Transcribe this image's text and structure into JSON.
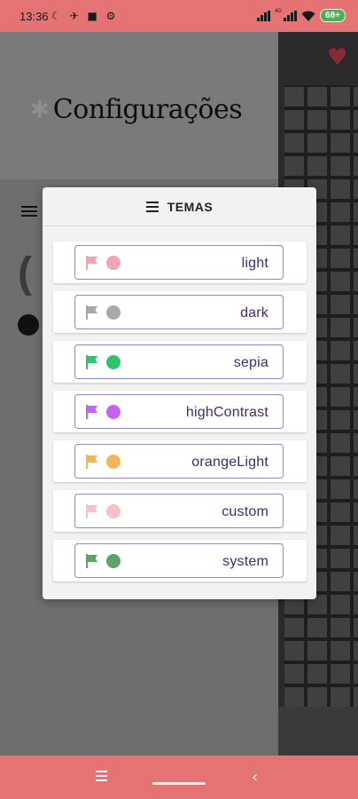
{
  "status_bar": {
    "time": "13:36",
    "notification_icons": "☾ ✈ ■ ⚙",
    "network_label": "4G",
    "battery": "68+"
  },
  "header": {
    "title": "Configurações",
    "icon": "gear-icon"
  },
  "dialog": {
    "title": "TEMAS",
    "themes": [
      {
        "label": "light",
        "color": "#f4a3b4"
      },
      {
        "label": "dark",
        "color": "#a8a8a8"
      },
      {
        "label": "sepia",
        "color": "#2ec46b"
      },
      {
        "label": "highContrast",
        "color": "#c462f2"
      },
      {
        "label": "orangeLight",
        "color": "#f2b659"
      },
      {
        "label": "custom",
        "color": "#f7c1c8"
      },
      {
        "label": "system",
        "color": "#5aa468"
      }
    ]
  },
  "colors": {
    "accent": "#e57373",
    "button_border": "#8f8cc8",
    "label_text": "#3f2a7a"
  }
}
